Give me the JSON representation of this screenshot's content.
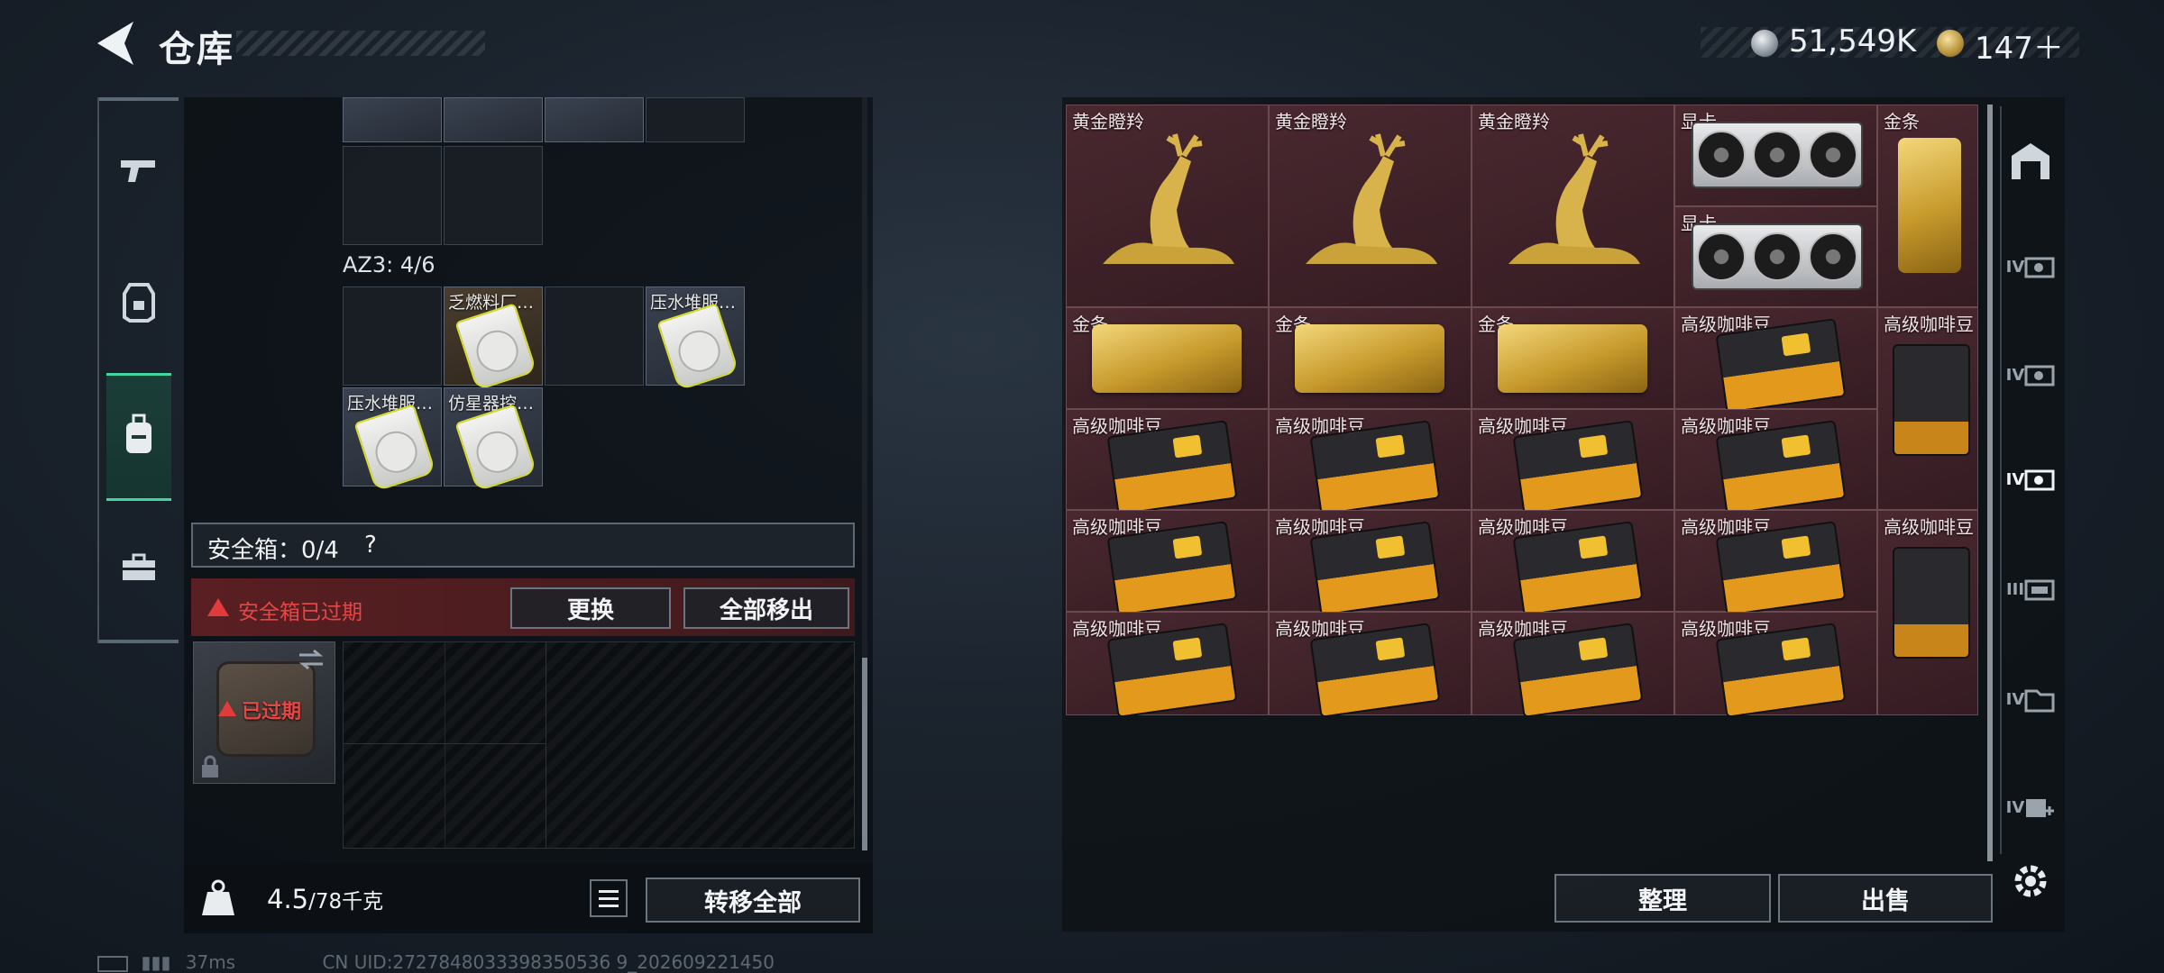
{
  "header": {
    "title": "仓库",
    "currency_silver": "51,549K",
    "currency_gold": "147＋"
  },
  "nav": {
    "items": [
      "weapons",
      "armor",
      "backpack",
      "toolbox"
    ]
  },
  "left_panel": {
    "top_cells": [
      {
        "label": ""
      },
      {
        "label": ""
      },
      {
        "label": ""
      },
      {
        "label": ""
      }
    ],
    "section_label": "AZ3: 4/6",
    "az3_cells": [
      {
        "label": "乏燃料厂…"
      },
      {
        "label": "压水堆服…"
      },
      {
        "label": "压水堆服…"
      },
      {
        "label": "仿星器控…"
      }
    ],
    "safe_box": {
      "label": "安全箱：0/4",
      "help": "?"
    },
    "expired_banner": {
      "text": "安全箱已过期",
      "replace_btn": "更换",
      "remove_all_btn": "全部移出"
    },
    "case": {
      "expired_text": "已过期"
    },
    "bottom": {
      "weight_current": "4.5",
      "weight_max": "/78千克",
      "transfer_btn": "转移全部"
    }
  },
  "inventory": {
    "deer": [
      "黄金瞪羚",
      "黄金瞪羚",
      "黄金瞪羚"
    ],
    "gpu": [
      "显卡",
      "显卡"
    ],
    "gold_bar_v": "金条",
    "gold_bars": [
      "金条",
      "金条",
      "金条"
    ],
    "coffee_top": "高级咖啡豆",
    "coffee_tall": [
      "高级咖啡豆",
      "高级咖啡豆"
    ],
    "coffee_rows": [
      [
        "高级咖啡豆",
        "高级咖啡豆",
        "高级咖啡豆",
        "高级咖啡豆"
      ],
      [
        "高级咖啡豆",
        "高级咖啡豆",
        "高级咖啡豆",
        "高级咖啡豆"
      ],
      [
        "高级咖啡豆",
        "高级咖啡豆",
        "高级咖啡豆",
        "高级咖啡豆"
      ]
    ]
  },
  "right_buttons": {
    "sort": "整理",
    "sell": "出售"
  },
  "side_icons": [
    "IV",
    "IV",
    "IV",
    "III",
    "IV",
    "IV"
  ],
  "status": {
    "ping": "37ms",
    "uid": "CN UID:2727848033398350536 9_202609221450"
  }
}
